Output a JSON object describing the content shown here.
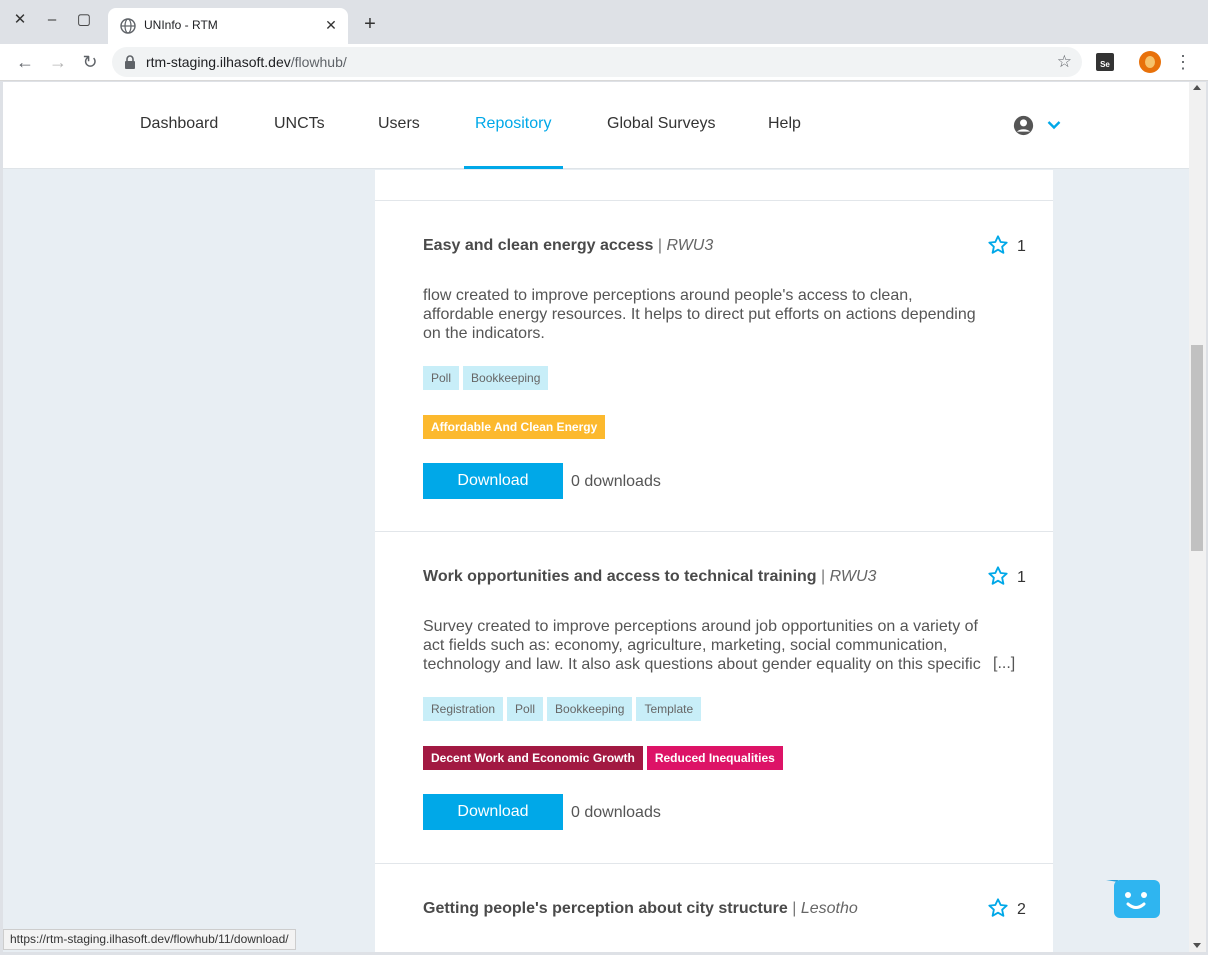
{
  "browser": {
    "tab_title": "UNInfo - RTM",
    "url_host": "rtm-staging.ilhasoft.dev",
    "url_path": "/flowhub/",
    "status_url": "https://rtm-staging.ilhasoft.dev/flowhub/11/download/",
    "icons": {
      "close_window": "close-icon",
      "minimize": "minimize-icon",
      "maximize": "maximize-icon",
      "tab_favicon": "globe-icon",
      "tab_close": "close-icon",
      "new_tab": "plus-icon",
      "back": "arrow-left-icon",
      "forward": "arrow-right-icon",
      "reload": "reload-icon",
      "lock": "lock-icon",
      "bookmark": "star-icon",
      "menu": "kebab-menu-icon"
    }
  },
  "nav": {
    "items": [
      {
        "label": "Dashboard",
        "active": false
      },
      {
        "label": "UNCTs",
        "active": false
      },
      {
        "label": "Users",
        "active": false
      },
      {
        "label": "Repository",
        "active": true
      },
      {
        "label": "Global Surveys",
        "active": false
      },
      {
        "label": "Help",
        "active": false
      }
    ]
  },
  "colors": {
    "accent": "#00a8e8",
    "tag_bg": "#c8eef8",
    "sdg_affordable_energy": "#fcb92e",
    "sdg_decent_work": "#a21942",
    "sdg_reduced_inequalities": "#dd1367"
  },
  "flows": [
    {
      "title": "Easy and clean energy access",
      "separator": "|",
      "country": "RWU3",
      "stars": "1",
      "description": "flow created to improve perceptions around people's access to clean, affordable energy resources. It helps to direct put efforts on actions depending on the indicators.",
      "tags": [
        "Poll",
        "Bookkeeping"
      ],
      "sdgs": [
        "Affordable And Clean Energy"
      ],
      "download_label": "Download",
      "downloads": "0 downloads"
    },
    {
      "title": "Work opportunities and access to technical training",
      "separator": "|",
      "country": "RWU3",
      "stars": "1",
      "description": "Survey created to improve perceptions around job opportunities on a variety of act fields such as: economy, agriculture, marketing, social communication, technology and law. It also ask questions about gender equality on this specific",
      "ellipsis": "[...]",
      "tags": [
        "Registration",
        "Poll",
        "Bookkeeping",
        "Template"
      ],
      "sdgs": [
        "Decent Work and Economic Growth",
        "Reduced Inequalities"
      ],
      "download_label": "Download",
      "downloads": "0 downloads"
    },
    {
      "title": "Getting people's perception about city structure",
      "separator": "|",
      "country": "Lesotho",
      "stars": "2"
    }
  ]
}
